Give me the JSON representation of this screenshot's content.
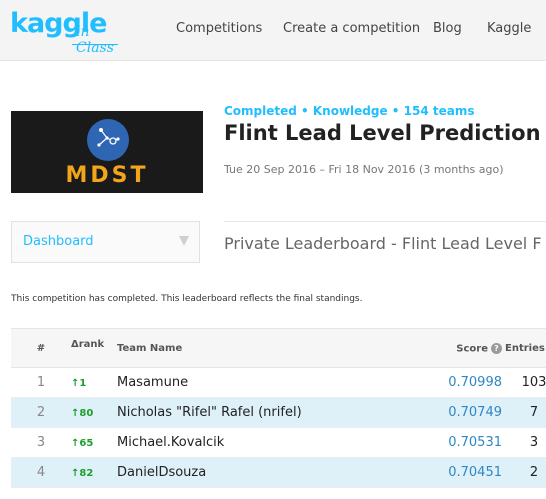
{
  "nav": {
    "logo_main": "kaggle",
    "logo_sub": "in Class",
    "links": [
      {
        "label": "Competitions"
      },
      {
        "label": "Create a competition"
      },
      {
        "label": "Blog"
      },
      {
        "label": "Kaggle"
      }
    ]
  },
  "competition": {
    "banner_text": "MDST",
    "meta": "Completed • Knowledge • 154 teams",
    "title": "Flint Lead Level Prediction",
    "dates": "Tue 20 Sep 2016 – Fri 18 Nov 2016 (3 months ago)"
  },
  "section_select": {
    "value": "Dashboard"
  },
  "leaderboard": {
    "title": "Private Leaderboard - Flint Lead Level F",
    "notice": "This competition has completed. This leaderboard reflects the final standings.",
    "columns": {
      "rank": "#",
      "delta": "Δrank",
      "team": "Team Name",
      "score": "Score",
      "entries": "Entries"
    },
    "rows": [
      {
        "rank": "1",
        "delta": "↑1",
        "team": "Masamune",
        "score": "0.70998",
        "entries": "103"
      },
      {
        "rank": "2",
        "delta": "↑80",
        "team": "Nicholas \"Rifel\" Rafel (nrifel)",
        "score": "0.70749",
        "entries": "7"
      },
      {
        "rank": "3",
        "delta": "↑65",
        "team": "Michael.Kovalcik",
        "score": "0.70531",
        "entries": "3"
      },
      {
        "rank": "4",
        "delta": "↑82",
        "team": "DanielDsouza",
        "score": "0.70451",
        "entries": "2"
      }
    ]
  },
  "colors": {
    "accent": "#20beff",
    "score_blue": "#2f86c6",
    "rank_up_green": "#1e9e2e",
    "row_highlight": "#def1f8",
    "banner_orange": "#f2a51a",
    "banner_circle": "#2e66b4"
  }
}
